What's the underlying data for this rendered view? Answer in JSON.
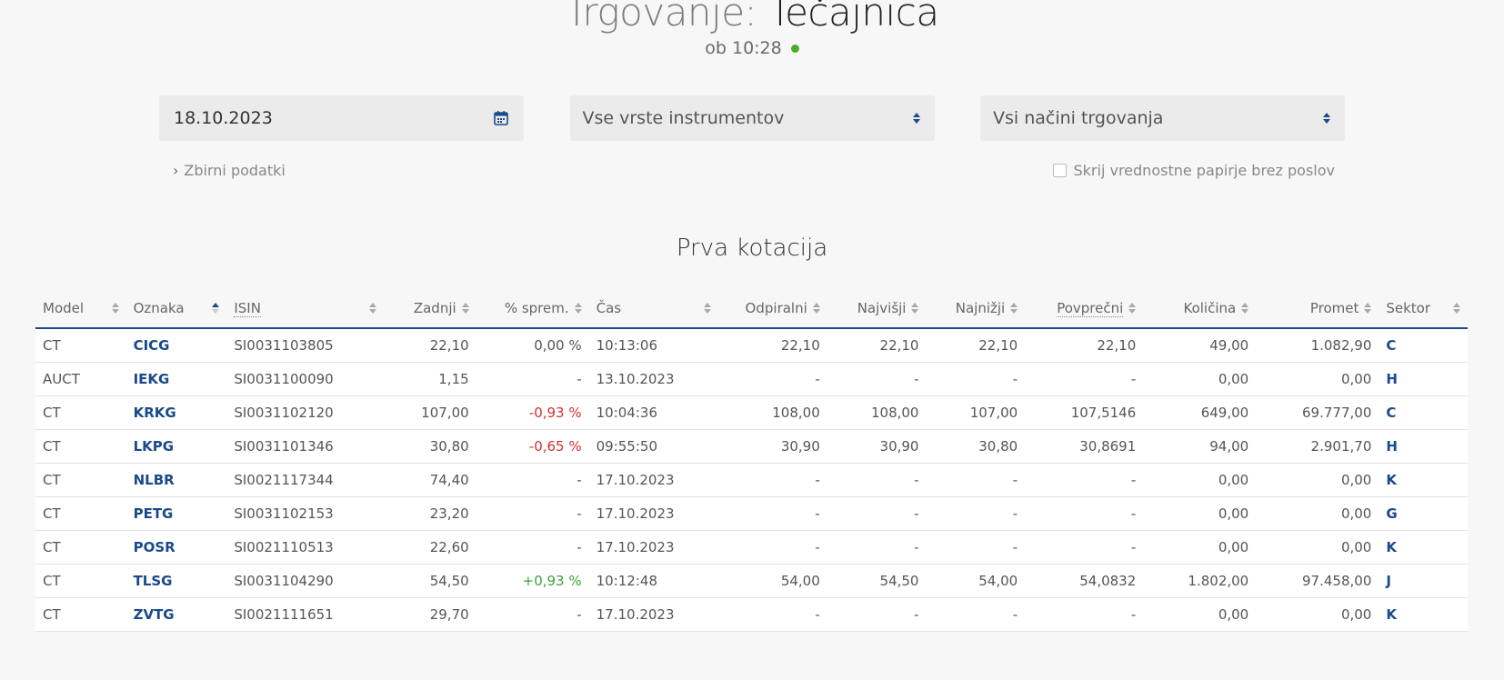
{
  "header": {
    "title_prefix": "Trgovanje:",
    "title_main": "Tečajnica",
    "time": "ob 10:28",
    "status_color": "#4caf2a"
  },
  "filters": {
    "date": "18.10.2023",
    "instrument_type": "Vse vrste instrumentov",
    "trading_mode": "Vsi načini trgovanja"
  },
  "links": {
    "summary": "Zbirni podatki",
    "hide_no_trades": "Skrij vrednostne papirje brez poslov"
  },
  "section_title": "Prva kotacija",
  "table": {
    "columns": [
      "Model",
      "Oznaka",
      "ISIN",
      "Zadnji",
      "% sprem.",
      "Čas",
      "Odpiralni",
      "Najvišji",
      "Najnižji",
      "Povprečni",
      "Količina",
      "Promet",
      "Sektor"
    ],
    "rows": [
      {
        "model": "CT",
        "symbol": "CICG",
        "isin": "SI0031103805",
        "last": "22,10",
        "change": "0,00 %",
        "change_dir": "flat",
        "time": "10:13:06",
        "open": "22,10",
        "high": "22,10",
        "low": "22,10",
        "avg": "22,10",
        "qty": "49,00",
        "turnover": "1.082,90",
        "sector": "C"
      },
      {
        "model": "AUCT",
        "symbol": "IEKG",
        "isin": "SI0031100090",
        "last": "1,15",
        "change": "-",
        "change_dir": "flat",
        "time": "13.10.2023",
        "open": "-",
        "high": "-",
        "low": "-",
        "avg": "-",
        "qty": "0,00",
        "turnover": "0,00",
        "sector": "H"
      },
      {
        "model": "CT",
        "symbol": "KRKG",
        "isin": "SI0031102120",
        "last": "107,00",
        "change": "-0,93 %",
        "change_dir": "neg",
        "time": "10:04:36",
        "open": "108,00",
        "high": "108,00",
        "low": "107,00",
        "avg": "107,5146",
        "qty": "649,00",
        "turnover": "69.777,00",
        "sector": "C"
      },
      {
        "model": "CT",
        "symbol": "LKPG",
        "isin": "SI0031101346",
        "last": "30,80",
        "change": "-0,65 %",
        "change_dir": "neg",
        "time": "09:55:50",
        "open": "30,90",
        "high": "30,90",
        "low": "30,80",
        "avg": "30,8691",
        "qty": "94,00",
        "turnover": "2.901,70",
        "sector": "H"
      },
      {
        "model": "CT",
        "symbol": "NLBR",
        "isin": "SI0021117344",
        "last": "74,40",
        "change": "-",
        "change_dir": "flat",
        "time": "17.10.2023",
        "open": "-",
        "high": "-",
        "low": "-",
        "avg": "-",
        "qty": "0,00",
        "turnover": "0,00",
        "sector": "K"
      },
      {
        "model": "CT",
        "symbol": "PETG",
        "isin": "SI0031102153",
        "last": "23,20",
        "change": "-",
        "change_dir": "flat",
        "time": "17.10.2023",
        "open": "-",
        "high": "-",
        "low": "-",
        "avg": "-",
        "qty": "0,00",
        "turnover": "0,00",
        "sector": "G"
      },
      {
        "model": "CT",
        "symbol": "POSR",
        "isin": "SI0021110513",
        "last": "22,60",
        "change": "-",
        "change_dir": "flat",
        "time": "17.10.2023",
        "open": "-",
        "high": "-",
        "low": "-",
        "avg": "-",
        "qty": "0,00",
        "turnover": "0,00",
        "sector": "K"
      },
      {
        "model": "CT",
        "symbol": "TLSG",
        "isin": "SI0031104290",
        "last": "54,50",
        "change": "+0,93 %",
        "change_dir": "pos",
        "time": "10:12:48",
        "open": "54,00",
        "high": "54,50",
        "low": "54,00",
        "avg": "54,0832",
        "qty": "1.802,00",
        "turnover": "97.458,00",
        "sector": "J"
      },
      {
        "model": "CT",
        "symbol": "ZVTG",
        "isin": "SI0021111651",
        "last": "29,70",
        "change": "-",
        "change_dir": "flat",
        "time": "17.10.2023",
        "open": "-",
        "high": "-",
        "low": "-",
        "avg": "-",
        "qty": "0,00",
        "turnover": "0,00",
        "sector": "K"
      }
    ]
  }
}
